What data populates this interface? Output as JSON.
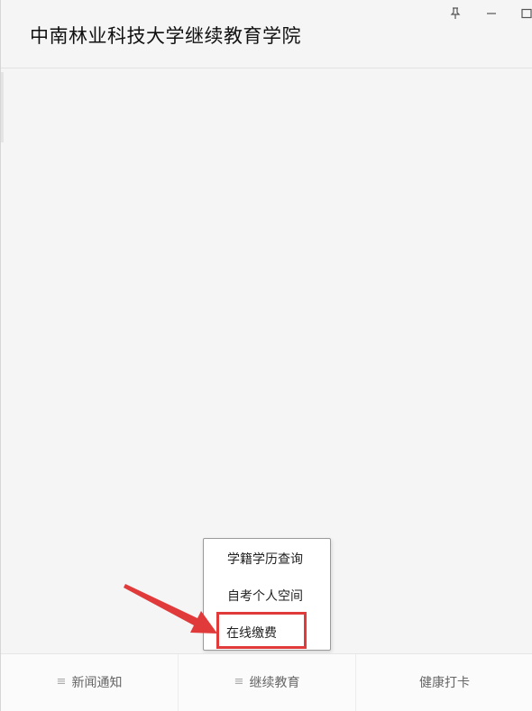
{
  "app": {
    "title": "中南林业科技大学继续教育学院"
  },
  "window_controls": {
    "pin_icon": "pin-icon",
    "minimize_icon": "minimize-icon",
    "maximize_icon": "maximize-icon"
  },
  "popup_menu": {
    "items": [
      {
        "label": "学籍学历查询"
      },
      {
        "label": "自考个人空间"
      },
      {
        "label": "在线缴费"
      }
    ],
    "highlighted_index": 2,
    "highlight_color": "#e03a3a",
    "arrow_color": "#e03a3a"
  },
  "tabbar": {
    "tabs": [
      {
        "label": "新闻通知",
        "icon": "menu-icon"
      },
      {
        "label": "继续教育",
        "icon": "menu-icon"
      },
      {
        "label": "健康打卡",
        "icon": ""
      }
    ]
  }
}
